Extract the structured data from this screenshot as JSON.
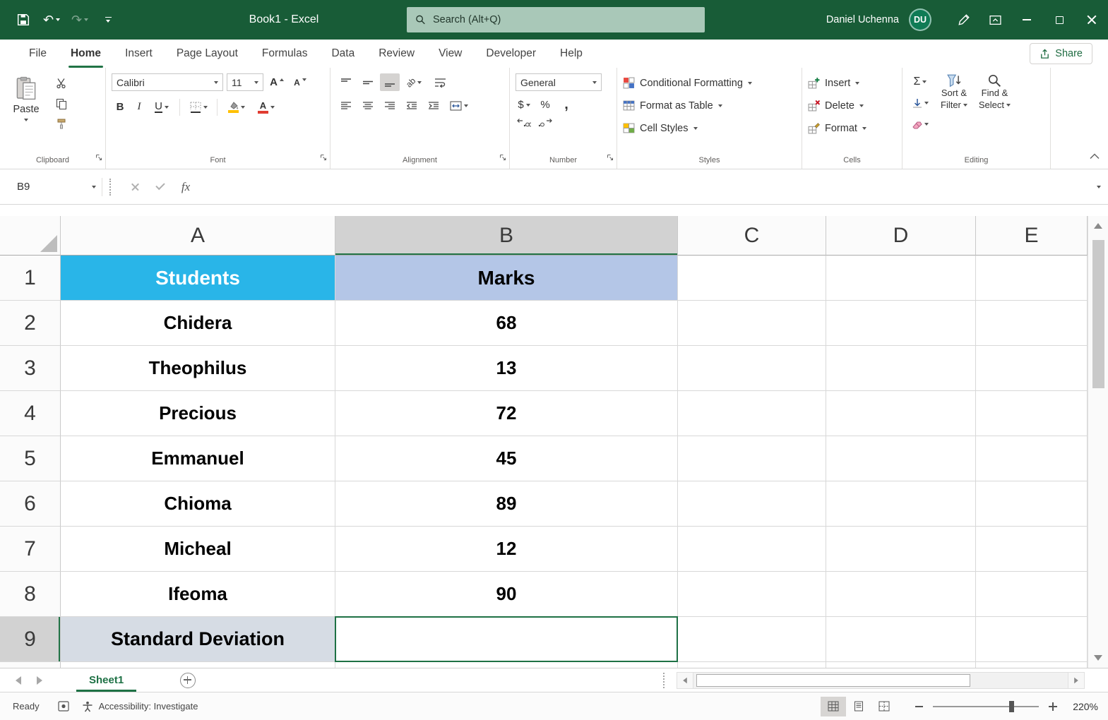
{
  "titlebar": {
    "workbook_title": "Book1  -  Excel",
    "search_placeholder": "Search (Alt+Q)",
    "user_name": "Daniel Uchenna",
    "user_initials": "DU"
  },
  "menubar": {
    "tabs": [
      "File",
      "Home",
      "Insert",
      "Page Layout",
      "Formulas",
      "Data",
      "Review",
      "View",
      "Developer",
      "Help"
    ],
    "active_tab": "Home",
    "share_label": "Share"
  },
  "ribbon": {
    "paste_label": "Paste",
    "font_name": "Calibri",
    "font_size": "11",
    "number_format": "General",
    "conditional_formatting": "Conditional Formatting",
    "format_as_table": "Format as Table",
    "cell_styles": "Cell Styles",
    "insert_label": "Insert",
    "delete_label": "Delete",
    "format_label": "Format",
    "sort_line1": "Sort &",
    "sort_line2": "Filter",
    "find_line1": "Find &",
    "find_line2": "Select",
    "group_labels": [
      "Clipboard",
      "Font",
      "Alignment",
      "Number",
      "Styles",
      "Cells",
      "Editing"
    ]
  },
  "glyphs": {
    "undo": "↶",
    "redo": "↷",
    "bold": "B",
    "italic": "I",
    "underline": "U",
    "letter_a": "A",
    "autosum": "Σ",
    "dollar": "$",
    "percent": "%",
    "comma": ",",
    "orientation": "ab",
    "fx": "fx"
  },
  "formula_bar": {
    "name_box": "B9",
    "formula_value": ""
  },
  "grid": {
    "col_headers": [
      "A",
      "B",
      "C",
      "D",
      "E"
    ],
    "selected_cell": "B9",
    "rows": [
      {
        "num": "1",
        "a": "Students",
        "b": "Marks"
      },
      {
        "num": "2",
        "a": "Chidera",
        "b": "68"
      },
      {
        "num": "3",
        "a": "Theophilus",
        "b": "13"
      },
      {
        "num": "4",
        "a": "Precious",
        "b": "72"
      },
      {
        "num": "5",
        "a": "Emmanuel",
        "b": "45"
      },
      {
        "num": "6",
        "a": "Chioma",
        "b": "89"
      },
      {
        "num": "7",
        "a": "Micheal",
        "b": "12"
      },
      {
        "num": "8",
        "a": "Ifeoma",
        "b": "90"
      },
      {
        "num": "9",
        "a": "Standard Deviation",
        "b": ""
      }
    ]
  },
  "sheetbar": {
    "sheet_name": "Sheet1"
  },
  "statusbar": {
    "ready": "Ready",
    "accessibility": "Accessibility: Investigate",
    "zoom": "220%"
  },
  "colors": {
    "titlebar_green": "#185C37",
    "accent_green": "#217346",
    "students_fill": "#29B5E8",
    "marks_fill": "#B4C6E7",
    "stddev_fill": "#D6DCE4"
  }
}
